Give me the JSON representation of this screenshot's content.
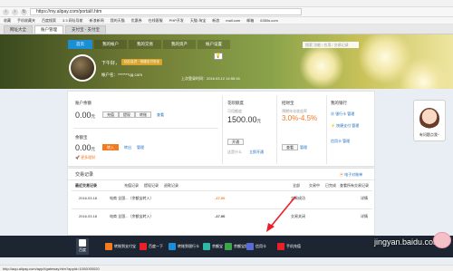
{
  "browser": {
    "url": "https://my.alipay.com/portal/i.htm",
    "bookmarks": [
      "收藏",
      "手机收藏夹",
      "百度搜索",
      "3.3 网址导航",
      "新浪新闻",
      "我的天猫",
      "优惠券",
      "在线客服",
      "PHP开发",
      "天猫·淘宝",
      "新浪",
      "mail.com",
      "邮箱",
      "6350s.com"
    ],
    "tabs": [
      "网址大全",
      "账户管理",
      "支付宝 - 支付宝"
    ]
  },
  "nav": {
    "items": [
      "首页",
      "我的帐户",
      "我的交易",
      "我的资产",
      "帐户设置"
    ],
    "search_placeholder": "搜索 功能 / 应用 / 交易记录"
  },
  "profile": {
    "name": "下午好，",
    "badge": "钻石会员 · 快捷支付安全",
    "account_label": "帐户名：",
    "account_value": "*******qq.com",
    "last_login": "上次登录时间：2016.03.12 14:55:16"
  },
  "balance": {
    "label": "账户余额",
    "amount": "0.00",
    "unit": "元",
    "btn_recharge": "充值",
    "btn_withdraw": "提现",
    "btn_transfer": "转账",
    "link_view": "查看"
  },
  "yuebao": {
    "label": "余额宝",
    "amount": "0.00",
    "unit": "元",
    "btn_in": "转入",
    "link_out": "转出",
    "link_manage": "管理",
    "note": "更多理财"
  },
  "credit": {
    "label": "花呗额度",
    "sub": "可用额度",
    "amount": "1500.00",
    "unit": "元",
    "btn_open": "开通",
    "link_q": "这是什么",
    "link_more": "立即开通"
  },
  "zhaocaibao": {
    "label": "招财宝",
    "rate": "3.0%-4.5%",
    "desc": "预期年化收益率",
    "btn": "查看",
    "link": "管理"
  },
  "bank": {
    "label": "我的银行",
    "items": [
      "银行卡 管理",
      "快捷支付 管理",
      "信用卡 管理"
    ]
  },
  "records": {
    "title": "交易记录",
    "tabs": [
      "最近交易记录",
      "充值记录",
      "提现记录",
      "退款记录"
    ],
    "right_link": "电子对账单",
    "filters": [
      "全部",
      "交易中",
      "已完成",
      "查看所有交易记录"
    ],
    "rows": [
      {
        "date": "2016.03.18",
        "desc": "电商 全国...（余额宝转入）",
        "amount": "-17.00",
        "status": "交易成功",
        "action": "详情"
      },
      {
        "date": "2016.03.18",
        "desc": "电商 全国...（余额宝转入）",
        "amount": "-17.00",
        "status": "交易关闭",
        "action": "详情"
      }
    ]
  },
  "taskbar": {
    "items": [
      "百度",
      "转账到支付宝",
      "百度一下",
      "转账到银行卡",
      "余额宝",
      "余额宝提现",
      "信用卡",
      "手机充值"
    ]
  },
  "status": "http://aqu.alipay.com/app/i/gateway.htm?appId=1000000020",
  "chat": "有问题点我~",
  "watermark": "jingyan.baidu.com",
  "colors": {
    "accent": "#1a8fd6",
    "orange": "#f47a1f",
    "taskbar": "#1c2531"
  }
}
